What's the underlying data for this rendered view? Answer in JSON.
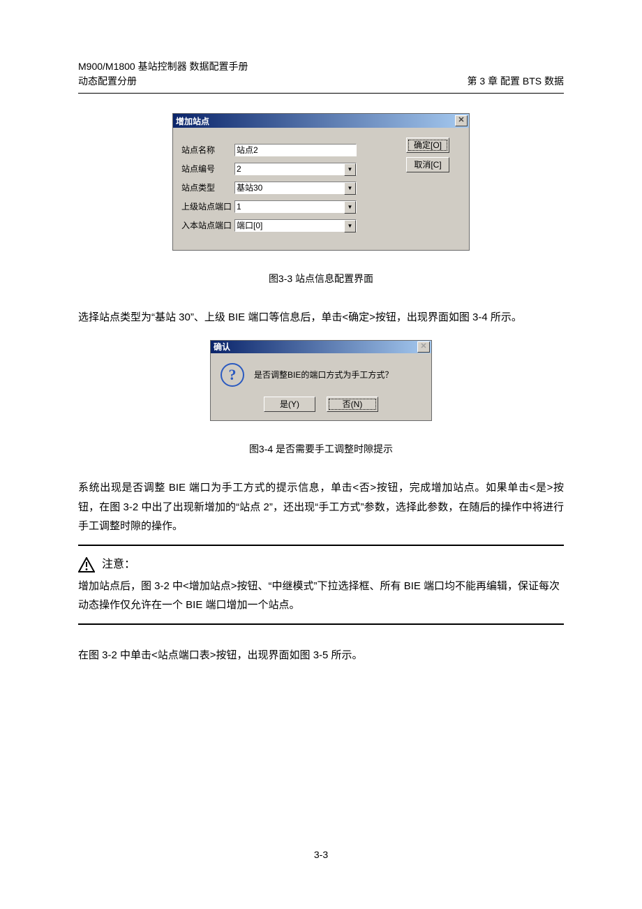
{
  "header": {
    "line1": "M900/M1800  基站控制器    数据配置手册",
    "line2_left": "动态配置分册",
    "line2_right": "第 3 章    配置 BTS 数据"
  },
  "dialog1": {
    "title": "增加站点",
    "close_x": "✕",
    "fields": {
      "name_label": "站点名称",
      "name_value": "站点2",
      "num_label": "站点编号",
      "num_value": "2",
      "type_label": "站点类型",
      "type_value": "基站30",
      "upper_port_label": "上级站点端口",
      "upper_port_value": "1",
      "in_port_label": "入本站点端口",
      "in_port_value": "端口[0]"
    },
    "buttons": {
      "ok": "确定[O]",
      "cancel": "取消[C]"
    }
  },
  "caption1": "图3-3  站点信息配置界面",
  "paragraph1": "选择站点类型为“基站 30”、上级 BIE 端口等信息后，单击<确定>按钮，出现界面如图 3-4 所示。",
  "dialog2": {
    "title": "确认",
    "close_x": "✕",
    "message": "是否调整BIE的端口方式为手工方式？",
    "yes": "是(Y)",
    "no": "否(N)"
  },
  "caption2": "图3-4  是否需要手工调整时隙提示",
  "paragraph2": "系统出现是否调整 BIE 端口为手工方式的提示信息，单击<否>按钮，完成增加站点。如果单击<是>按钮，在图 3-2 中出了出现新增加的“站点 2”，还出现“手工方式”参数，选择此参数，在随后的操作中将进行手工调整时隙的操作。",
  "note": {
    "title": "注意：",
    "text": "增加站点后，图 3-2 中<增加站点>按钮、“中继模式”下拉选择框、所有 BIE 端口均不能再编辑，保证每次动态操作仅允许在一个 BIE 端口增加一个站点。"
  },
  "paragraph3": "在图 3-2 中单击<站点端口表>按钮，出现界面如图 3-5 所示。",
  "page_number": "3-3"
}
